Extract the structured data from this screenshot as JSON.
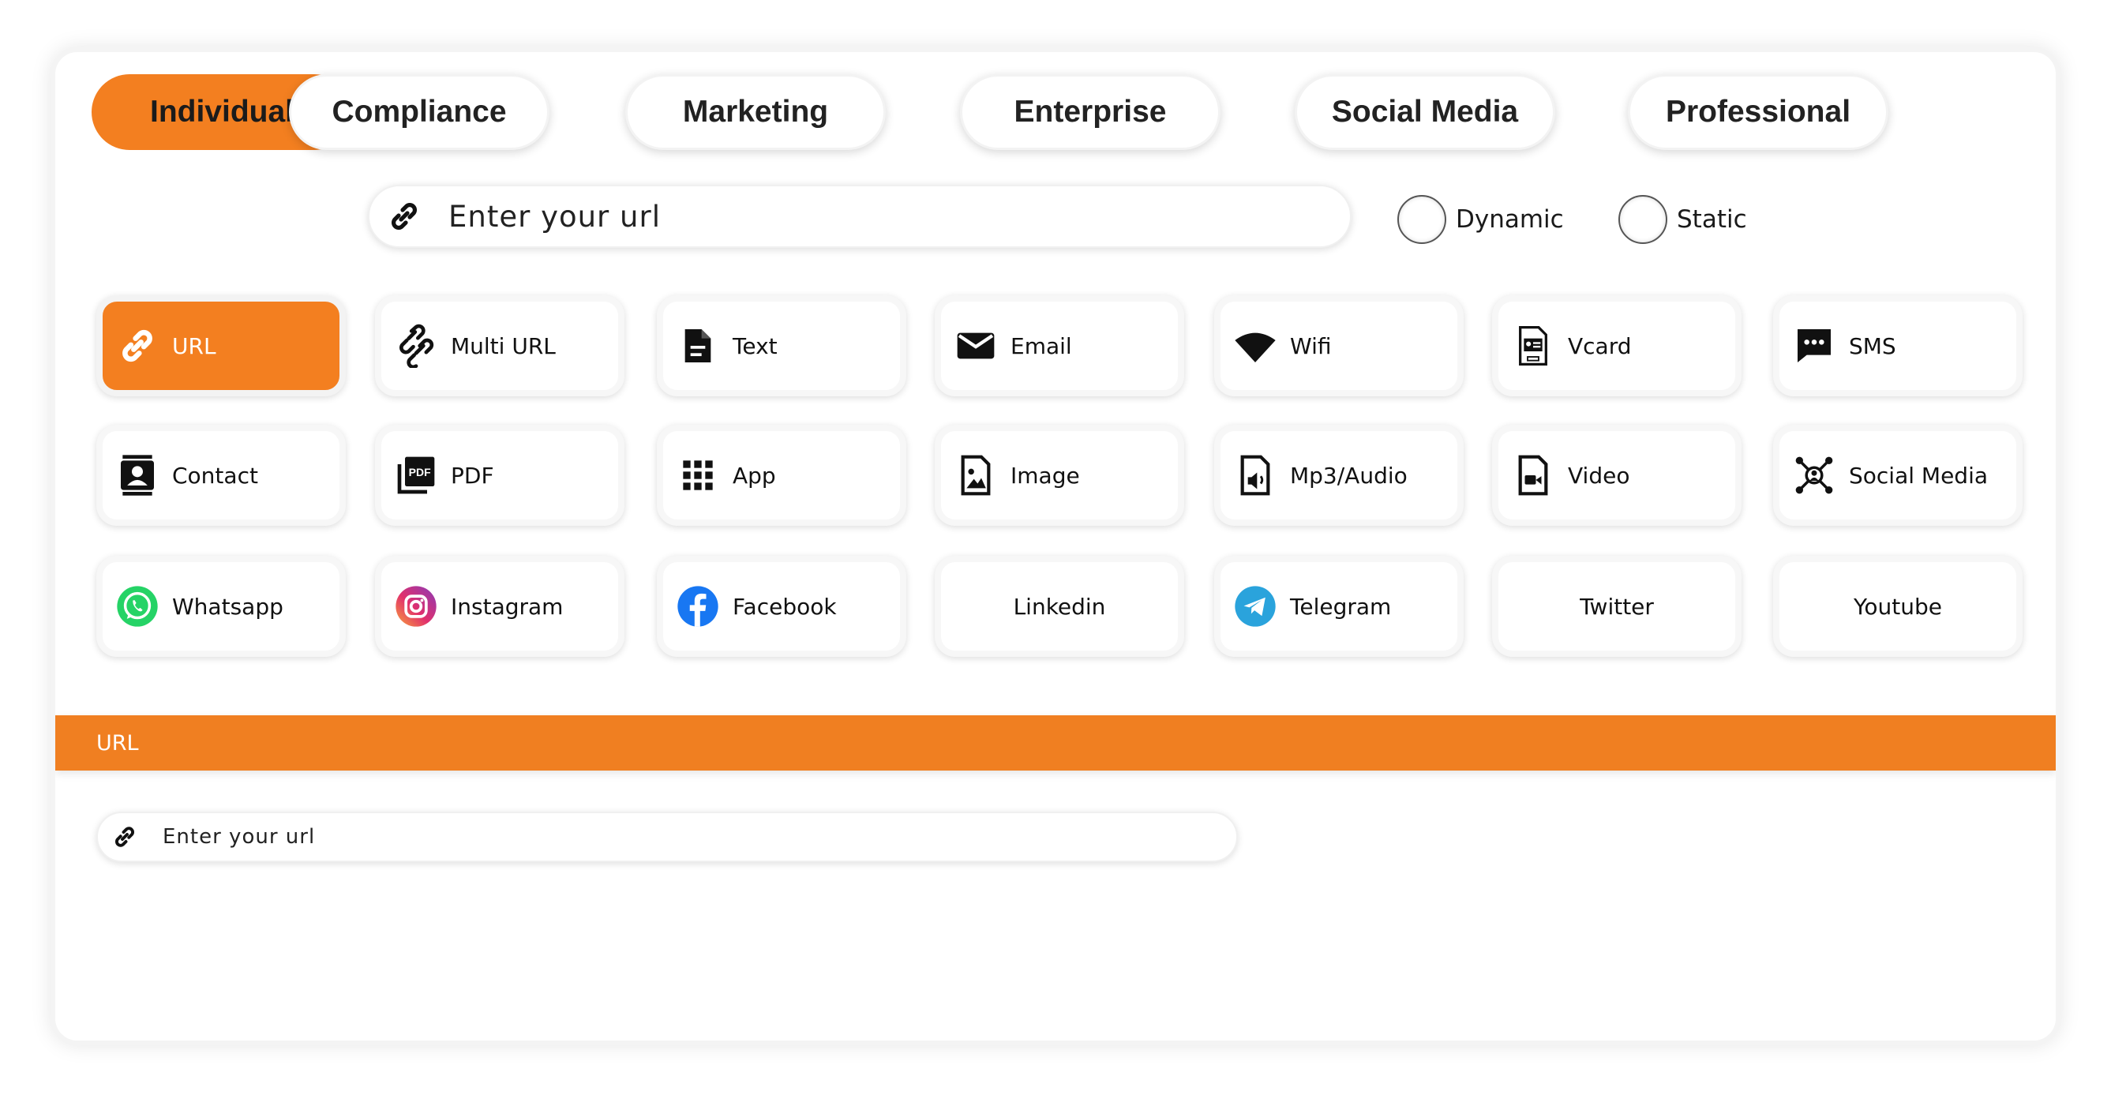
{
  "tabs": [
    {
      "label": "Individual",
      "active": true
    },
    {
      "label": "Compliance",
      "active": false
    },
    {
      "label": "Marketing",
      "active": false
    },
    {
      "label": "Enterprise",
      "active": false
    },
    {
      "label": "Social Media",
      "active": false
    },
    {
      "label": "Professional",
      "active": false
    }
  ],
  "url_input": {
    "placeholder": "Enter your url"
  },
  "mode_options": [
    {
      "label": "Dynamic",
      "selected": false
    },
    {
      "label": "Static",
      "selected": false
    }
  ],
  "types": [
    {
      "label": "URL",
      "icon": "link-icon",
      "active": true
    },
    {
      "label": "Multi URL",
      "icon": "multi-link-icon"
    },
    {
      "label": "Text",
      "icon": "document-icon"
    },
    {
      "label": "Email",
      "icon": "envelope-icon"
    },
    {
      "label": "Wifi",
      "icon": "wifi-icon"
    },
    {
      "label": "Vcard",
      "icon": "vcard-file-icon"
    },
    {
      "label": "SMS",
      "icon": "chat-bubble-icon"
    },
    {
      "label": "Contact",
      "icon": "contact-book-icon"
    },
    {
      "label": "PDF",
      "icon": "pdf-icon"
    },
    {
      "label": "App",
      "icon": "app-grid-icon"
    },
    {
      "label": "Image",
      "icon": "image-file-icon"
    },
    {
      "label": "Mp3/Audio",
      "icon": "audio-file-icon"
    },
    {
      "label": "Video",
      "icon": "video-file-icon"
    },
    {
      "label": "Social Media",
      "icon": "social-network-icon"
    },
    {
      "label": "Whatsapp",
      "icon": "whatsapp-icon"
    },
    {
      "label": "Instagram",
      "icon": "instagram-icon"
    },
    {
      "label": "Facebook",
      "icon": "facebook-icon"
    },
    {
      "label": "Linkedin",
      "icon": ""
    },
    {
      "label": "Telegram",
      "icon": "telegram-icon"
    },
    {
      "label": "Twitter",
      "icon": ""
    },
    {
      "label": "Youtube",
      "icon": ""
    }
  ],
  "section": {
    "title": "URL"
  },
  "section_input": {
    "placeholder": "Enter your url"
  },
  "colors": {
    "accent": "#f37f20",
    "whatsapp": "#25d366",
    "facebook": "#1877f2",
    "telegram": "#2aa3dc"
  }
}
